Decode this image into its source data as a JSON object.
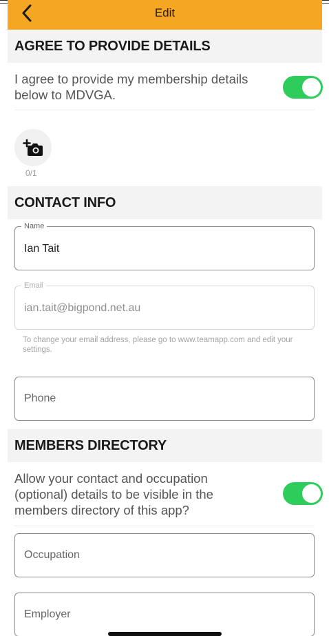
{
  "header": {
    "title": "Edit",
    "back_icon": "chevron-left-icon",
    "background": "#f5a623"
  },
  "agree": {
    "section_title": "AGREE TO PROVIDE DETAILS",
    "text": "I agree to provide my membership details below to MDVGA.",
    "toggle_on": true
  },
  "photo": {
    "icon": "add-photo-camera-icon",
    "count": "0/1"
  },
  "contact": {
    "section_title": "CONTACT INFO",
    "name_label": "Name",
    "name_value": "Ian Tait",
    "email_label": "Email",
    "email_value": "ian.tait@bigpond.net.au",
    "email_helper": "To change your email address, please go to www.teamapp.com and edit your settings.",
    "phone_placeholder": "Phone"
  },
  "directory": {
    "section_title": "MEMBERS DIRECTORY",
    "text": "Allow your contact and occupation (optional) details to be visible in the members directory of this app?",
    "toggle_on": true,
    "occupation_placeholder": "Occupation",
    "employer_placeholder": "Employer"
  },
  "colors": {
    "accent": "#f5a623",
    "toggle_on": "#2ecc5a",
    "section_bg": "#f3f3f3"
  }
}
